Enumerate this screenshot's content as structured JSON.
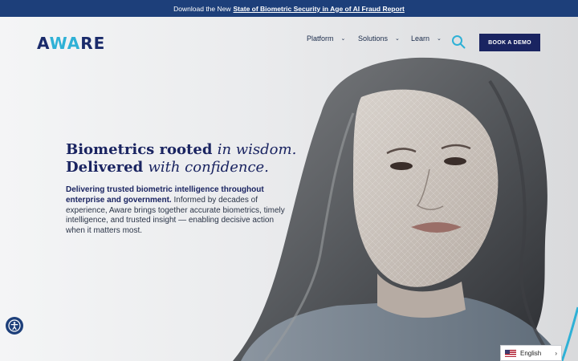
{
  "promo": {
    "prefix": "Download the New",
    "link": "State of Biometric Security in Age of AI Fraud Report"
  },
  "header": {
    "logo": {
      "part1": "A",
      "part2": "WA",
      "part3": "RE"
    },
    "nav": [
      {
        "label": "Platform"
      },
      {
        "label": "Solutions"
      },
      {
        "label": "Learn"
      }
    ],
    "cta": "BOOK A DEMO"
  },
  "hero": {
    "line1_bold": "Biometrics rooted",
    "line1_italic": "in wisdom.",
    "line2_bold": "Delivered",
    "line2_italic": "with confidence.",
    "lead_bold": "Delivering trusted biometric intelligence throughout enterprise and government.",
    "lead_rest": "Informed by decades of experience, Aware brings together accurate biometrics, timely intelligence, and trusted insight — enabling decisive action when it matters most."
  },
  "language": {
    "selected": "English"
  },
  "icons": {
    "search": "search-icon",
    "accessibility": "accessibility-icon",
    "chevron": "chevron-down-icon",
    "flag": "us-flag-icon"
  },
  "colors": {
    "navy": "#1a2461",
    "cyan": "#2fb1d6",
    "promo_bg": "#1d3f7a"
  }
}
